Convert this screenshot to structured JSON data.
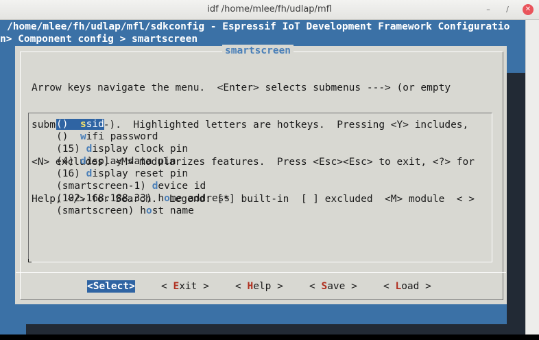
{
  "window": {
    "title": "idf /home/mlee/fh/udlap/mfl"
  },
  "header": {
    "path_line": "/home/mlee/fh/udlap/mfl/sdkconfig - Espressif IoT Development Framework Configuratio",
    "breadcrumb": "n> Component config > smartscreen"
  },
  "dialog": {
    "title": "smartscreen",
    "help_lines": [
      "Arrow keys navigate the menu.  <Enter> selects submenus ---> (or empty",
      "submenus ----).  Highlighted letters are hotkeys.  Pressing <Y> includes,",
      "<N> excludes, <M> modularizes features.  Press <Esc><Esc> to exit, <?> for",
      "Help, </> for Search.  Legend: [*] built-in  [ ] excluded  <M> module  < >"
    ],
    "items": [
      {
        "value": "()",
        "gap": "  ",
        "hot": "s",
        "rest": "sid",
        "selected": true
      },
      {
        "value": "()",
        "gap": "  ",
        "hot": "w",
        "rest": "ifi password",
        "selected": false
      },
      {
        "value": "(15)",
        "gap": " ",
        "hot": "d",
        "rest": "isplay clock pin",
        "selected": false
      },
      {
        "value": "(4)",
        "gap": " ",
        "hot": "d",
        "rest": "isplay data pin",
        "selected": false
      },
      {
        "value": "(16)",
        "gap": " ",
        "hot": "d",
        "rest": "isplay reset pin",
        "selected": false
      },
      {
        "value": "(smartscreen-1)",
        "gap": " ",
        "hot": "d",
        "rest": "evice id",
        "selected": false
      },
      {
        "value": "(192.168.188.33)",
        "gap": " ",
        "pre": "h",
        "hot": "o",
        "rest": "me address",
        "selected": false
      },
      {
        "value": "(smartscreen)",
        "gap": " ",
        "pre": "h",
        "hot": "o",
        "rest": "st name",
        "selected": false
      }
    ],
    "buttons": {
      "select": {
        "open": "<",
        "hot": "S",
        "rest": "elect>"
      },
      "exit": {
        "open": "< ",
        "hot": "E",
        "rest": "xit >"
      },
      "help": {
        "open": "< ",
        "hot": "H",
        "rest": "elp >"
      },
      "save": {
        "open": "< ",
        "hot": "S",
        "rest": "ave >"
      },
      "load": {
        "open": "< ",
        "hot": "L",
        "rest": "oad >"
      }
    }
  },
  "colors": {
    "terminal_bg": "#3b71a6",
    "dialog_bg": "#d8d8d2",
    "hotkey_menu": "#4a7fb8",
    "hotkey_button": "#b03020",
    "selection": "#2f64a3"
  }
}
